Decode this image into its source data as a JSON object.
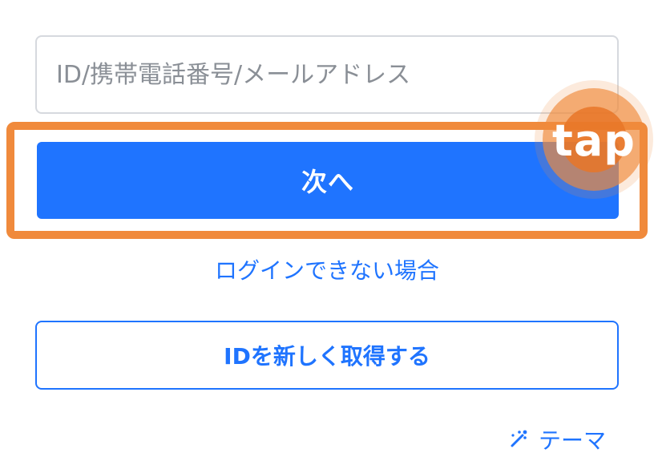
{
  "login_form": {
    "id_input": {
      "placeholder": "ID/携帯電話番号/メールアドレス",
      "value": ""
    },
    "next_button": {
      "label": "次へ"
    },
    "tap_hint": {
      "label": "tap"
    },
    "trouble_link": {
      "label": "ログインできない場合"
    },
    "new_id_button": {
      "label": "IDを新しく取得する"
    },
    "theme_link": {
      "label": "テーマ",
      "icon": "sparkle-wand-icon"
    }
  },
  "colors": {
    "primary": "#1f74ff",
    "highlight": "#f08a3c",
    "input_border": "#d6d9de",
    "placeholder": "#8a8f96"
  }
}
